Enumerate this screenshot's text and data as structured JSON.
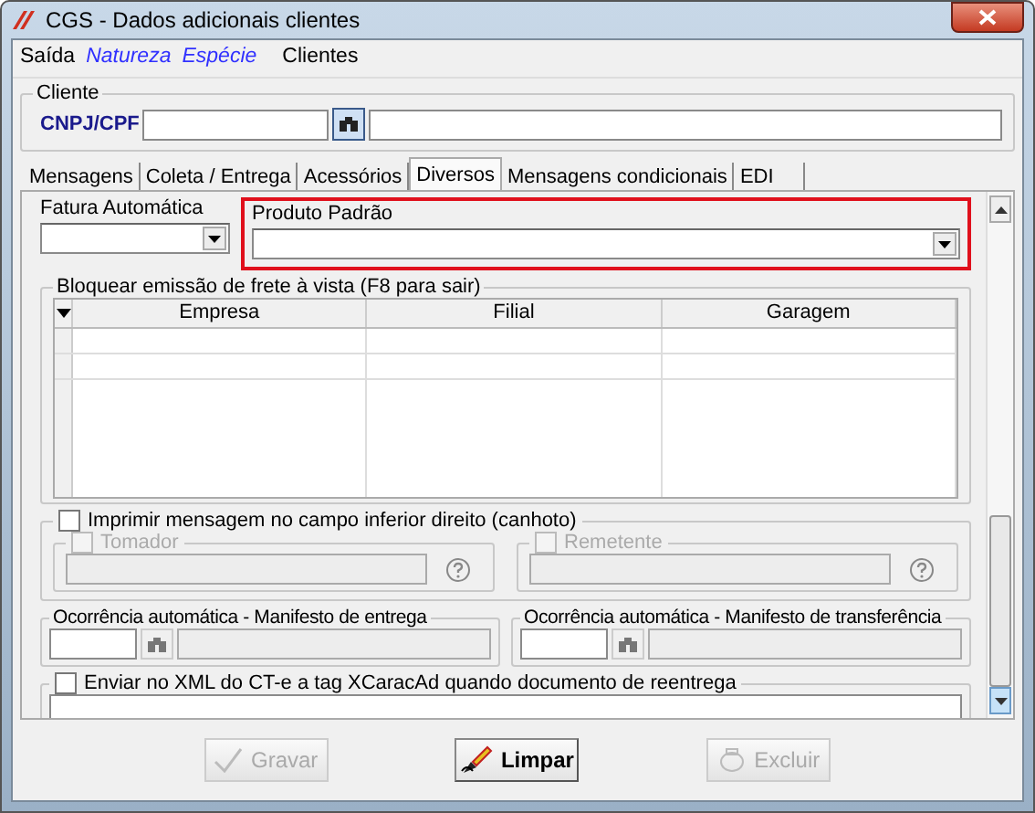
{
  "window": {
    "title": "CGS - Dados adicionais clientes"
  },
  "menu": [
    {
      "label": "Saída",
      "kind": "plain"
    },
    {
      "label": "Natureza",
      "kind": "link"
    },
    {
      "label": "Espécie",
      "kind": "link"
    },
    {
      "label": "Clientes",
      "kind": "plain"
    }
  ],
  "cliente": {
    "title": "Cliente",
    "field_label": "CNPJ/CPF"
  },
  "tabs": [
    {
      "label": "Mensagens",
      "selected": false
    },
    {
      "label": "Coleta / Entrega",
      "selected": false
    },
    {
      "label": "Acessórios",
      "selected": false
    },
    {
      "label": "Diversos",
      "selected": true
    },
    {
      "label": "Mensagens condicionais",
      "selected": false
    },
    {
      "label": "EDI",
      "selected": false
    }
  ],
  "fatura": {
    "label": "Fatura Automática"
  },
  "produto": {
    "label": "Produto Padrão",
    "highlighted": true
  },
  "bloquear": {
    "title": "Bloquear emissão de frete à vista (F8 para sair)",
    "columns": [
      "Empresa",
      "Filial",
      "Garagem"
    ]
  },
  "imprimir": {
    "label": "Imprimir mensagem no campo inferior direito (canhoto)",
    "checked": false,
    "parts": [
      {
        "label": "Tomador",
        "checked": false,
        "disabled": true
      },
      {
        "label": "Remetente",
        "checked": false,
        "disabled": true
      }
    ]
  },
  "ocorrencias": [
    {
      "title": "Ocorrência automática - Manifesto de entrega"
    },
    {
      "title": "Ocorrência automática - Manifesto de transferência"
    }
  ],
  "enviar": {
    "label": "Enviar no XML do CT-e a tag XCaracAd quando documento de reentrega",
    "checked": false
  },
  "buttons": [
    {
      "label": "Gravar",
      "kind": "save",
      "disabled": true
    },
    {
      "label": "Limpar",
      "kind": "clear",
      "disabled": false
    },
    {
      "label": "Excluir",
      "kind": "delete",
      "disabled": true
    }
  ]
}
